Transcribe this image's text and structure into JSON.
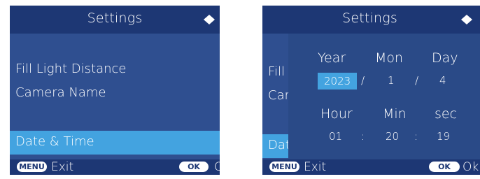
{
  "left_screen": {
    "title": "Settings",
    "items": [
      "Fill Light Distance",
      "Camera Name"
    ],
    "selected_item": "Date & Time",
    "footer": {
      "menu_key": "MENU",
      "exit_label": "Exit",
      "ok_key": "OK",
      "ok_label": "Ok"
    }
  },
  "right_screen": {
    "title": "Settings",
    "items_partial": [
      "Fill",
      "Car",
      "Dat"
    ],
    "date_dialog": {
      "labels": {
        "year": "Year",
        "month": "Mon",
        "day": "Day",
        "hour": "Hour",
        "minute": "Min",
        "second": "sec"
      },
      "values": {
        "year": "2023",
        "month": "1",
        "day": "4",
        "hour": "01",
        "minute": "20",
        "second": "19"
      },
      "date_separator": "/",
      "time_separator": ":"
    },
    "footer": {
      "menu_key": "MENU",
      "exit_label": "Exit",
      "ok_key": "OK",
      "ok_label": "Ok"
    }
  },
  "icons": {
    "scroll": "up-down-triangle-icon"
  },
  "colors": {
    "background": "#2f4f90",
    "header": "#1d3774",
    "highlight": "#43a3e0",
    "text": "#ffffff"
  }
}
